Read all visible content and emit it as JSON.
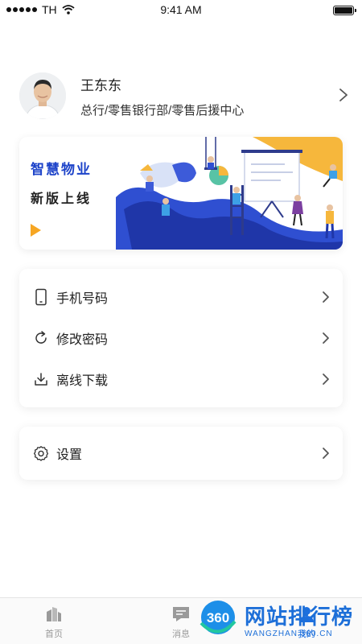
{
  "status_bar": {
    "carrier": "TH",
    "time": "9:41 AM"
  },
  "profile": {
    "name": "王东东",
    "department": "总行/零售银行部/零售后援中心"
  },
  "banner": {
    "title": "智慧物业",
    "subtitle": "新版上线",
    "colors": {
      "accent_blue": "#1d43c9",
      "accent_yellow": "#f6a623"
    }
  },
  "menu_group_1": [
    {
      "label": "手机号码",
      "icon": "phone-icon"
    },
    {
      "label": "修改密码",
      "icon": "refresh-icon"
    },
    {
      "label": "离线下载",
      "icon": "download-icon"
    }
  ],
  "menu_group_2": [
    {
      "label": "设置",
      "icon": "gear-icon"
    }
  ],
  "tabbar": {
    "tabs": [
      {
        "label": "首页",
        "icon": "building-icon"
      },
      {
        "label": "消息",
        "icon": "message-icon"
      },
      {
        "label": "我的",
        "icon": "user-icon"
      }
    ],
    "active_color": "#1c6fe0"
  },
  "watermark": {
    "logo_text": "360",
    "title": "网站排行榜",
    "url": "WANGZHAN.360.CN"
  }
}
